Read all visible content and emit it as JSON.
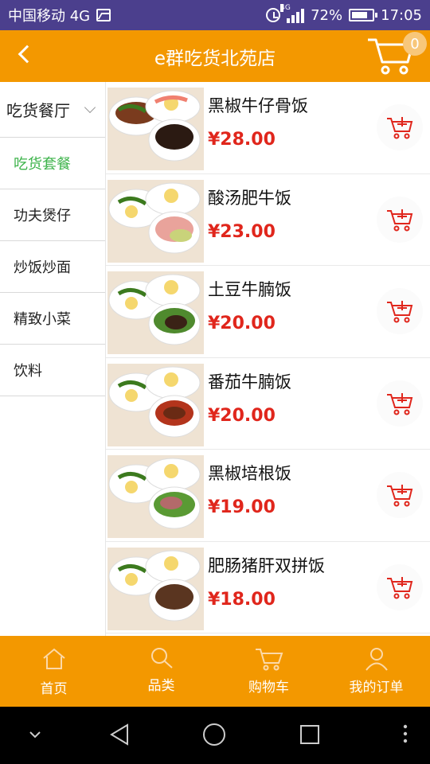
{
  "status_bar": {
    "carrier": "中国移动 4G",
    "network_small": "4G",
    "battery": "72%",
    "time": "17:05"
  },
  "header": {
    "title": "e群吃货北苑店",
    "cart_count": "0"
  },
  "sidebar": {
    "category_header": "吃货餐厅",
    "items": [
      {
        "label": "吃货套餐",
        "active": true
      },
      {
        "label": "功夫煲仔",
        "active": false
      },
      {
        "label": "炒饭炒面",
        "active": false
      },
      {
        "label": "精致小菜",
        "active": false
      },
      {
        "label": "饮料",
        "active": false
      }
    ]
  },
  "products": [
    {
      "name": "黑椒牛仔骨饭",
      "price": "¥28.00"
    },
    {
      "name": "酸汤肥牛饭",
      "price": "¥23.00"
    },
    {
      "name": "土豆牛腩饭",
      "price": "¥20.00"
    },
    {
      "name": "番茄牛腩饭",
      "price": "¥20.00"
    },
    {
      "name": "黑椒培根饭",
      "price": "¥19.00"
    },
    {
      "name": "肥肠猪肝双拼饭",
      "price": "¥18.00"
    }
  ],
  "bottom_nav": {
    "home": "首页",
    "category": "品类",
    "cart": "购物车",
    "orders": "我的订单"
  },
  "icons": {
    "back": "chevron-left-icon",
    "cart": "cart-icon",
    "add_cart": "add-to-cart-icon",
    "home": "home-icon",
    "search": "search-icon",
    "user": "user-icon"
  },
  "colors": {
    "brand": "#f39800",
    "price": "#e0261c",
    "active_category": "#3cb34a",
    "status_bar": "#4b3f8d"
  }
}
